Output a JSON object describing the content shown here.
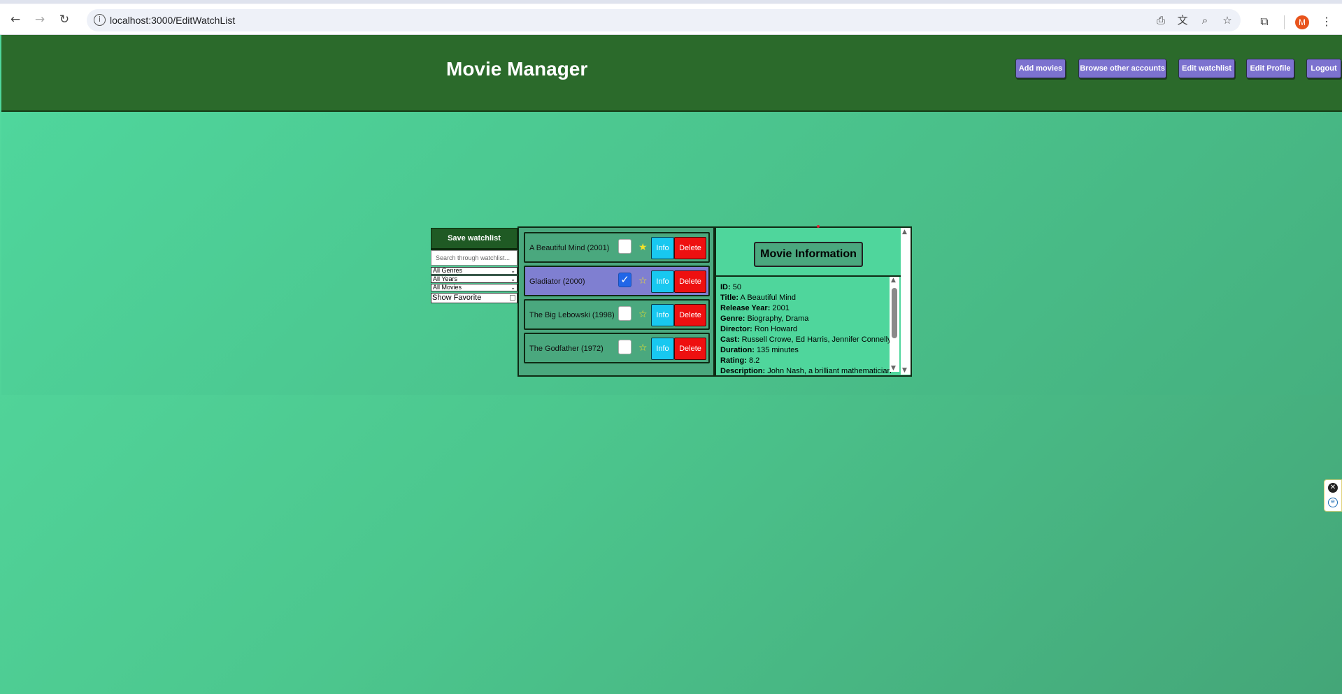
{
  "browser": {
    "url": "localhost:3000/EditWatchList",
    "profile_initial": "M",
    "icons": {
      "back": "arrow-left-icon",
      "forward": "arrow-right-icon",
      "reload": "reload-icon",
      "site_info": "info-icon",
      "install": "install-app-icon",
      "translate": "translate-icon",
      "zoom": "zoom-icon",
      "bookmark": "star-icon",
      "extensions": "puzzle-icon",
      "menu": "kebab-menu-icon"
    }
  },
  "header": {
    "title": "Movie Manager",
    "nav": [
      {
        "label": "Add movies"
      },
      {
        "label": "Browse other accounts"
      },
      {
        "label": "Edit watchlist"
      },
      {
        "label": "Edit Profile"
      },
      {
        "label": "Logout"
      }
    ]
  },
  "controls": {
    "save_label": "Save watchlist",
    "search_placeholder": "Search through watchlist...",
    "genre_filter": "All Genres",
    "year_filter": "All Years",
    "movie_filter": "All Movies",
    "show_favorite_label": "Show Favorite",
    "show_favorite_checked": false
  },
  "watchlist": [
    {
      "title": "A Beautiful Mind (2001)",
      "checked": false,
      "selected": false,
      "info_label": "Info",
      "delete_label": "Delete"
    },
    {
      "title": "Gladiator (2000)",
      "checked": true,
      "selected": true,
      "info_label": "Info",
      "delete_label": "Delete"
    },
    {
      "title": "The Big Lebowski (1998)",
      "checked": false,
      "selected": false,
      "info_label": "Info",
      "delete_label": "Delete"
    },
    {
      "title": "The Godfather (1972)",
      "checked": false,
      "selected": false,
      "info_label": "Info",
      "delete_label": "Delete"
    }
  ],
  "info": {
    "heading": "Movie Information",
    "fields": [
      {
        "label": "ID:",
        "value": "50"
      },
      {
        "label": "Title:",
        "value": "A Beautiful Mind"
      },
      {
        "label": "Release Year:",
        "value": "2001"
      },
      {
        "label": "Genre:",
        "value": "Biography, Drama"
      },
      {
        "label": "Director:",
        "value": "Ron Howard"
      },
      {
        "label": "Cast:",
        "value": "Russell Crowe, Ed Harris, Jennifer Connelly"
      },
      {
        "label": "Duration:",
        "value": "135 minutes"
      },
      {
        "label": "Rating:",
        "value": "8.2"
      },
      {
        "label": "Description:",
        "value": "John Nash, a brilliant mathematician"
      }
    ]
  },
  "colors": {
    "header_bg": "#2b6a2b",
    "nav_button": "#7c72cf",
    "main_bg": "#4fd69c",
    "info_button": "#18c8f0",
    "delete_button": "#ee1010",
    "selected_row": "#7f7fd1"
  }
}
